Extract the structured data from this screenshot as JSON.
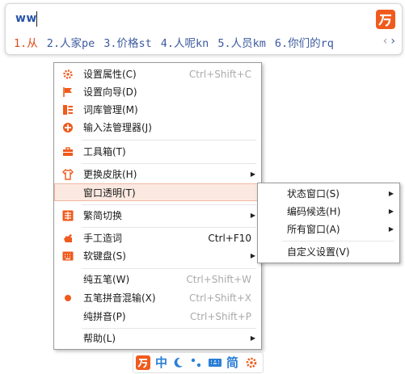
{
  "candidate": {
    "input_text": "ww",
    "candidates": [
      "1.从",
      "2.人家pe",
      "3.价格st",
      "4.人呢kn",
      "5.人员km",
      "6.你们的rq"
    ],
    "prev_arrow": "‹",
    "next_arrow": "›"
  },
  "menu": {
    "items": [
      {
        "label": "设置属性(C)",
        "shortcut": "Ctrl+Shift+C",
        "icon": "gear-icon"
      },
      {
        "label": "设置向导(D)",
        "icon": "flag-icon"
      },
      {
        "label": "词库管理(M)",
        "icon": "dictionary-icon"
      },
      {
        "label": "输入法管理器(J)",
        "icon": "manager-icon"
      },
      {
        "label": "工具箱(T)",
        "icon": "toolbox-icon"
      },
      {
        "label": "更换皮肤(H)",
        "icon": "shirt-icon"
      },
      {
        "label": "窗口透明(T)"
      },
      {
        "label": "繁简切换",
        "icon": "traditional-chinese-icon"
      },
      {
        "label": "手工造词",
        "shortcut": "Ctrl+F10",
        "icon": "hand-icon"
      },
      {
        "label": "软键盘(S)",
        "icon": "soft-keyboard-icon"
      },
      {
        "label": "纯五笔(W)",
        "shortcut": "Ctrl+Shift+W"
      },
      {
        "label": "五笔拼音混输(X)",
        "shortcut": "Ctrl+Shift+X",
        "icon": "dot-icon"
      },
      {
        "label": "纯拼音(P)",
        "shortcut": "Ctrl+Shift+P"
      },
      {
        "label": "帮助(L)"
      }
    ]
  },
  "submenu": {
    "items": [
      {
        "label": "状态窗口(S)"
      },
      {
        "label": "编码候选(H)"
      },
      {
        "label": "所有窗口(A)"
      },
      {
        "label": "自定义设置(V)"
      }
    ]
  },
  "statusbar": {
    "mode_label": "中",
    "simplified_label": "简"
  },
  "colors": {
    "accent": "#f05a1c",
    "candidate_text": "#3c5aa0",
    "highlight_bg": "#fbe9e1",
    "status_blue": "#2b7fd6"
  }
}
